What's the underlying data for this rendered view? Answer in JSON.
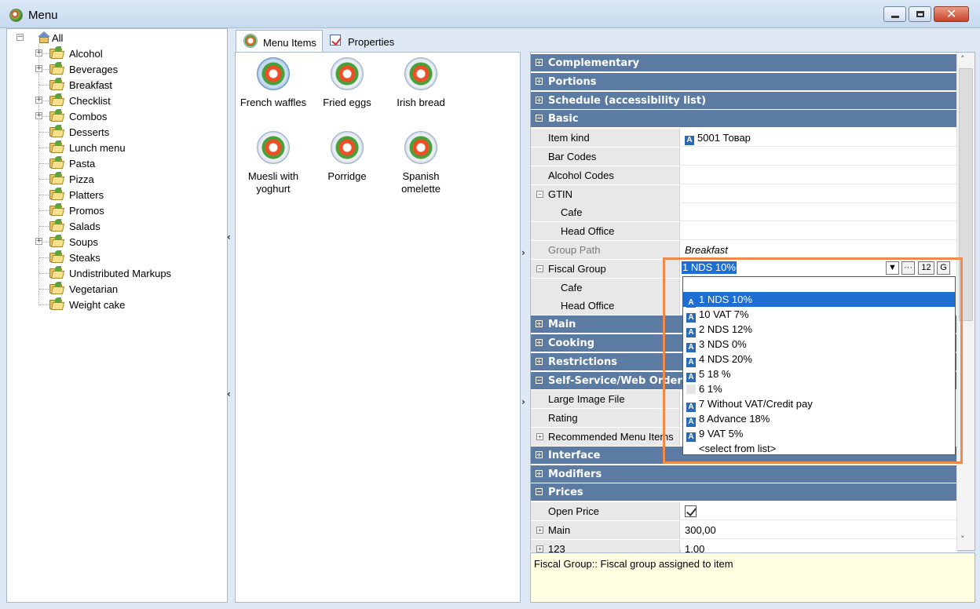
{
  "window": {
    "title": "Menu"
  },
  "tree": {
    "root": "All",
    "items": [
      {
        "label": "Alcohol",
        "expandable": true
      },
      {
        "label": "Beverages",
        "expandable": true
      },
      {
        "label": "Breakfast",
        "expandable": false,
        "selected": true
      },
      {
        "label": "Checklist",
        "expandable": true
      },
      {
        "label": "Combos",
        "expandable": true
      },
      {
        "label": "Desserts",
        "expandable": false
      },
      {
        "label": "Lunch menu",
        "expandable": false
      },
      {
        "label": "Pasta",
        "expandable": false
      },
      {
        "label": "Pizza",
        "expandable": false
      },
      {
        "label": "Platters",
        "expandable": false
      },
      {
        "label": "Promos",
        "expandable": false
      },
      {
        "label": "Salads",
        "expandable": false
      },
      {
        "label": "Soups",
        "expandable": true
      },
      {
        "label": "Steaks",
        "expandable": false
      },
      {
        "label": "Undistributed Markups",
        "expandable": false
      },
      {
        "label": "Vegetarian",
        "expandable": false
      },
      {
        "label": "Weight cake",
        "expandable": false
      }
    ]
  },
  "tabs": {
    "menu_items": "Menu Items",
    "properties": "Properties"
  },
  "menu_items": [
    "French waffles",
    "Fried eggs",
    "Irish bread",
    "Muesli with yoghurt",
    "Porridge",
    "Spanish omelette"
  ],
  "categories": {
    "complementary": "Complementary",
    "portions": "Portions",
    "schedule": "Schedule (accessibility list)",
    "basic": "Basic",
    "main": "Main",
    "cooking": "Cooking",
    "restrictions": "Restrictions",
    "self_service": "Self-Service/Web Order",
    "interface": "Interface",
    "modifiers": "Modifiers",
    "prices": "Prices"
  },
  "props": {
    "item_kind": {
      "name": "Item kind",
      "value": "5001 Товар"
    },
    "bar_codes": {
      "name": "Bar Codes"
    },
    "alcohol_codes": {
      "name": "Alcohol Codes"
    },
    "gtin": {
      "name": "GTIN"
    },
    "gtin_cafe": {
      "name": "Cafe"
    },
    "gtin_head_office": {
      "name": "Head Office"
    },
    "group_path": {
      "name": "Group Path",
      "value": "Breakfast"
    },
    "fiscal_group": {
      "name": "Fiscal Group",
      "value": "1 NDS 10%"
    },
    "fiscal_cafe": {
      "name": "Cafe"
    },
    "fiscal_head_office": {
      "name": "Head Office"
    },
    "large_image": {
      "name": "Large Image File"
    },
    "rating": {
      "name": "Rating"
    },
    "recommended": {
      "name": "Recommended Menu Items"
    },
    "open_price": {
      "name": "Open Price",
      "checked": true
    },
    "main_price": {
      "name": "Main",
      "value": "300,00"
    },
    "price_123": {
      "name": "123",
      "value": "1,00"
    }
  },
  "fiscal_editor": {
    "btn_more": "···",
    "btn_12": "12",
    "btn_g": "G"
  },
  "fiscal_options": [
    {
      "label": "1 NDS 10%",
      "selected": true,
      "badge": true
    },
    {
      "label": "10 VAT 7%",
      "badge": true
    },
    {
      "label": "2 NDS 12%",
      "badge": true
    },
    {
      "label": "3 NDS 0%",
      "badge": true
    },
    {
      "label": "4 NDS 20%",
      "badge": true
    },
    {
      "label": "5 18 %",
      "badge": true
    },
    {
      "label": "6 1%",
      "badge": false
    },
    {
      "label": "7 Without VAT/Credit pay",
      "badge": true
    },
    {
      "label": "8 Advance 18%",
      "badge": true
    },
    {
      "label": "9 VAT 5%",
      "badge": true
    },
    {
      "label": "<select from list>",
      "badge": false
    }
  ],
  "description": "Fiscal Group:: Fiscal group assigned to item",
  "colors": {
    "category_bg": "#5b7ba3",
    "selection": "#1e6fd1",
    "highlight": "#ef8a4a"
  }
}
